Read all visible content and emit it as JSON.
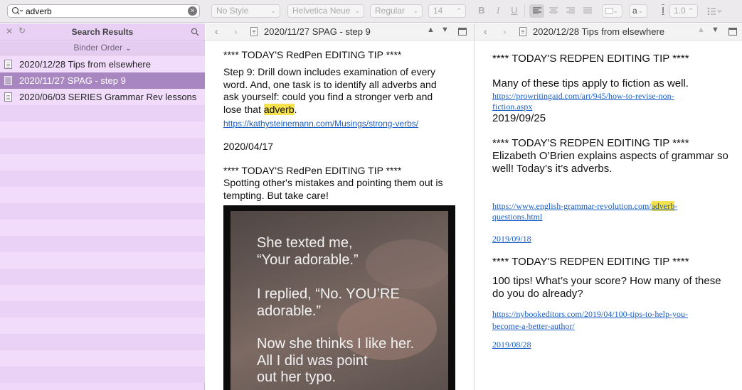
{
  "search": {
    "value": "adverb"
  },
  "toolbar": {
    "style": "No Style",
    "font": "Helvetica Neue",
    "weight": "Regular",
    "size": "14",
    "bold": "B",
    "italic": "I",
    "underline": "U",
    "highlight_glyph": "a",
    "line_spacing_glyph": "I",
    "line_spacing": "1.0"
  },
  "binder": {
    "title": "Search Results",
    "order_label": "Binder Order",
    "items": [
      {
        "label": "2020/12/28 Tips from elsewhere",
        "selected": false
      },
      {
        "label": "2020/11/27 SPAG - step 9",
        "selected": true
      },
      {
        "label": "2020/06/03 SERIES Grammar Rev lessons",
        "selected": false
      }
    ]
  },
  "pane1": {
    "title": "2020/11/27 SPAG - step 9",
    "tip1_heading": "**** TODAY'S RedPen EDITING TIP ****",
    "tip1_text_before": "Step 9: Drill down includes examination of every word. And, one task is to identify all adverbs and ask yourself: could you find a stronger verb and lose that ",
    "tip1_text_hl": "adverb",
    "tip1_text_after": ".",
    "tip1_link": "https://kathysteinemann.com/Musings/strong-verbs/",
    "date": "2020/04/17",
    "tip2_heading": "**** TODAY'S RedPen EDITING TIP ****",
    "tip2_text": "Spotting other's mistakes and pointing them out is tempting. But take care!",
    "meme_lines": [
      "She texted me,",
      "“Your adorable.”",
      "I replied, “No. YOU’RE",
      "adorable.”",
      "Now she thinks I like her.",
      "All I did was point",
      "out her typo."
    ]
  },
  "pane2": {
    "title": "2020/12/28 Tips from elsewhere",
    "tip1_heading": "**** TODAY'S REDPEN EDITING TIP ****",
    "tip1_text": "Many of these tips apply to fiction as well.",
    "tip1_link": "https://prowritingaid.com/art/945/how-to-revise-non-fiction.aspx",
    "date1": "2019/09/25",
    "tip2_heading": "**** TODAY'S REDPEN EDITING TIP ****",
    "tip2_text": "Elizabeth O’Brien explains aspects of grammar so well! Today’s it’s adverbs.",
    "tip2_link_before": "https://www.english-grammar-revolution.com/",
    "tip2_link_hl": "adverb",
    "tip2_link_after": "-questions.html",
    "date2": "2019/09/18",
    "tip3_heading": "**** TODAY'S REDPEN EDITING TIP ****",
    "tip3_text": "100 tips! What’s your score? How many of these do you do already?",
    "tip3_link": "https://nybookeditors.com/2019/04/100-tips-to-help-you-become-a-better-author/",
    "date3": "2019/08/28"
  }
}
